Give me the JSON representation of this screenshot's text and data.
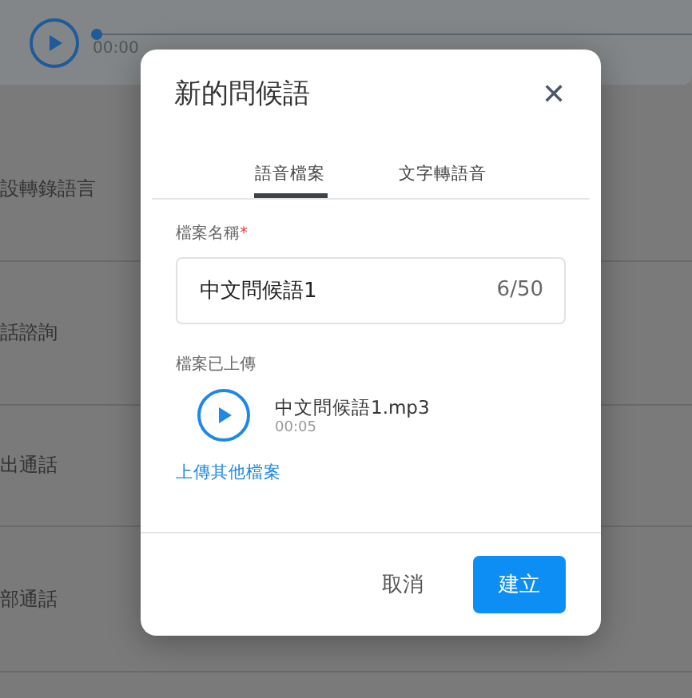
{
  "background": {
    "player": {
      "level": 0,
      "time": "00:00"
    },
    "rows": [
      {
        "label": "設轉錄語言"
      },
      {
        "label": "話諮詢"
      },
      {
        "label": "出通話"
      },
      {
        "label": "部通話"
      }
    ]
  },
  "dialog": {
    "title": "新的問候語",
    "close": "✕",
    "tabs": [
      {
        "label": "語音檔案",
        "selected": true
      },
      {
        "label": "文字轉語音",
        "selected": false
      }
    ],
    "field": {
      "label": "檔案名稱",
      "required_mark": "*",
      "value": "中文問候語1",
      "counter": "6/50"
    },
    "uploaded_label": "檔案已上傳",
    "file": {
      "name": "中文問候語1.mp3",
      "duration": "00:05"
    },
    "link": "上傳其他檔案",
    "buttons": [
      {
        "label": "取消",
        "kind": "text"
      },
      {
        "label": "建立",
        "kind": "primary"
      }
    ]
  }
}
